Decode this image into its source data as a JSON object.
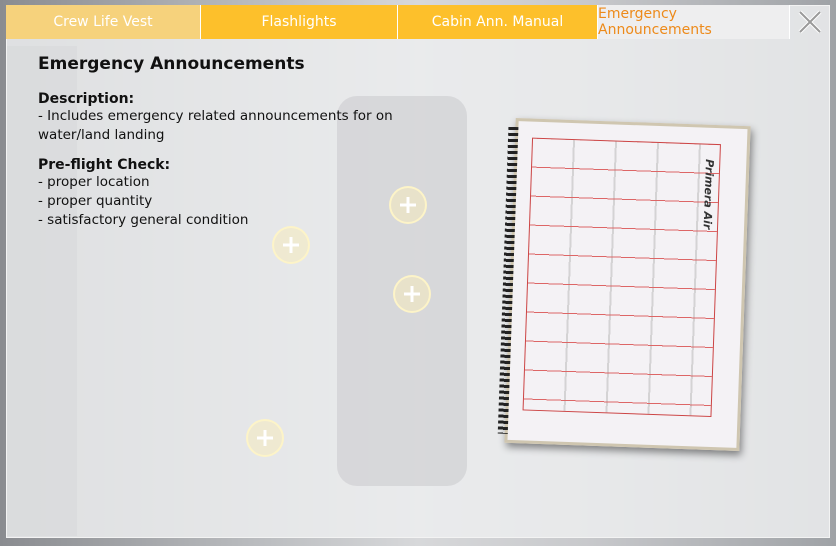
{
  "tabs": [
    {
      "label": "Crew Life Vest",
      "active": false
    },
    {
      "label": "Flashlights",
      "active": false
    },
    {
      "label": "Cabin Ann. Manual",
      "active": false
    },
    {
      "label": "Emergency Announcements",
      "active": true
    }
  ],
  "close_icon": "close-x-icon",
  "content": {
    "title": "Emergency Announcements",
    "description_heading": "Description:",
    "description_text": "- Includes emergency related announcements for on water/land landing",
    "check_heading": "Pre-flight Check:",
    "check_items": [
      "- proper location",
      "- proper quantity",
      "- satisfactory general condition"
    ]
  },
  "image": {
    "logo_text": "Primera Air"
  },
  "colors": {
    "tab": "#fdc02b",
    "tab_inactive_first": "#f6d27c",
    "active_text": "#ed8a1a"
  }
}
